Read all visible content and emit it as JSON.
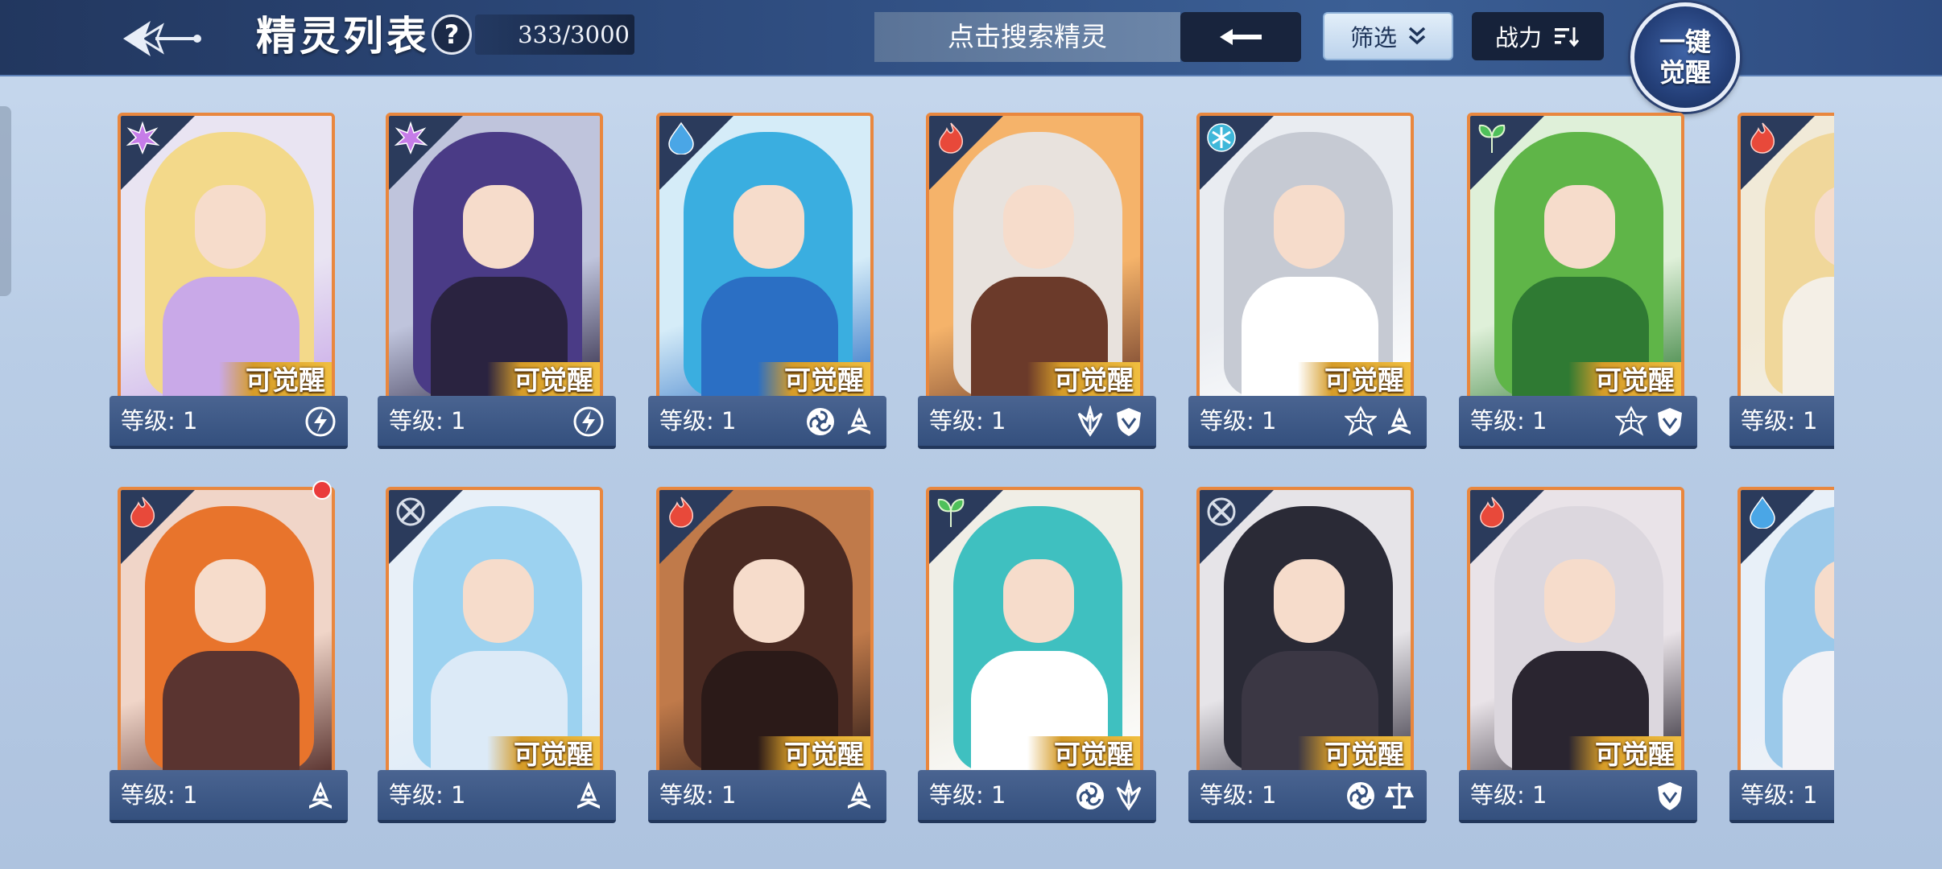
{
  "header": {
    "title": "精灵列表",
    "help_label": "?",
    "count": "333/3000",
    "search_placeholder": "点击搜索精灵",
    "filter_label": "筛选",
    "sort_label": "战力",
    "awaken_all_line1": "一键",
    "awaken_all_line2": "觉醒"
  },
  "card_common": {
    "awakenable": "可觉醒",
    "level_text": "等级: 1"
  },
  "colors": {
    "card_border": "#e9873e",
    "header_bg": "#2d4a7c",
    "awaken_tag": "#d69c28"
  },
  "cards": [
    {
      "element": "storm-icon",
      "roles": [
        "lightning-icon"
      ],
      "palette": "purple-blonde",
      "awakenable": true
    },
    {
      "element": "storm-icon",
      "roles": [
        "lightning-icon"
      ],
      "palette": "purple-dark",
      "awakenable": true
    },
    {
      "element": "water-icon",
      "roles": [
        "swirl-icon",
        "book-icon"
      ],
      "palette": "blue",
      "awakenable": true
    },
    {
      "element": "fire-icon",
      "roles": [
        "claw-icon",
        "shield-icon"
      ],
      "palette": "fire",
      "awakenable": true
    },
    {
      "element": "ice-icon",
      "roles": [
        "star-icon",
        "book-icon"
      ],
      "palette": "silver",
      "awakenable": true
    },
    {
      "element": "leaf-icon",
      "roles": [
        "star-icon",
        "shield-icon"
      ],
      "palette": "green",
      "awakenable": true
    },
    {
      "element": "fire-icon",
      "roles": [],
      "palette": "gold-blonde",
      "awakenable": false
    },
    {
      "element": "fire-icon",
      "roles": [
        "book-icon"
      ],
      "palette": "orange-wings",
      "awakenable": false,
      "red_dot": true
    },
    {
      "element": "cross-icon",
      "roles": [
        "book-icon"
      ],
      "palette": "light-blue",
      "awakenable": true
    },
    {
      "element": "fire-icon",
      "roles": [
        "book-icon"
      ],
      "palette": "dragon",
      "awakenable": true
    },
    {
      "element": "leaf-icon",
      "roles": [
        "swirl-icon",
        "claw-icon"
      ],
      "palette": "teal",
      "awakenable": true
    },
    {
      "element": "cross-icon",
      "roles": [
        "swirl-icon",
        "scale-icon"
      ],
      "palette": "dark-gold",
      "awakenable": true
    },
    {
      "element": "fire-icon",
      "roles": [
        "shield-icon"
      ],
      "palette": "white-red",
      "awakenable": true
    },
    {
      "element": "water-icon",
      "roles": [],
      "palette": "pale-blue",
      "awakenable": false
    }
  ]
}
